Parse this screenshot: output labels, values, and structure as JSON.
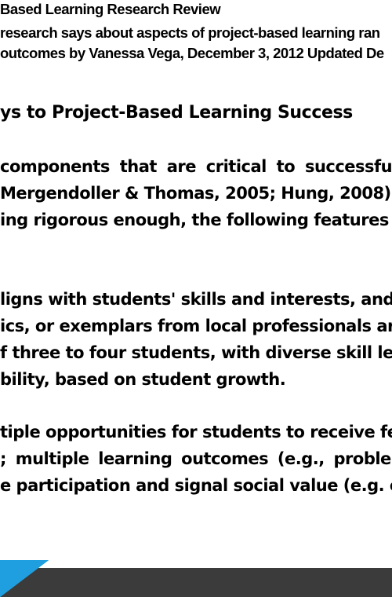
{
  "header": {
    "line1": "Based Learning Research Review",
    "line2": " research says about aspects of project-based learning ran",
    "line3": "outcomes by Vanessa Vega, December 3, 2012 Updated De"
  },
  "section": {
    "title": "ys to Project-Based Learning Success"
  },
  "body": {
    "lines": [
      " components that are critical to successful",
      "Mergendoller & Thomas, 2005; Hung, 2008).",
      "ing rigorous enough, the following features w",
      "ligns with students' skills and interests, and",
      "ics, or exemplars from local professionals ar",
      "f three to four students, with diverse skill lev",
      "bility, based on student growth.",
      "tiple opportunities for students to receive fe",
      "; multiple learning outcomes (e.g., problem",
      "e participation and signal social value (e.g. e"
    ]
  },
  "colors": {
    "footer_bar": "#3b3b3b",
    "footer_accent": "#1f9fe0"
  }
}
